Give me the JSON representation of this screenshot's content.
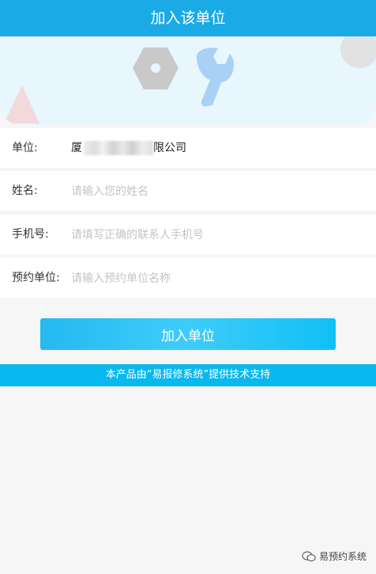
{
  "header": {
    "title": "加入该单位"
  },
  "banner": {
    "icons": [
      "hexagon-nut-icon",
      "wrench-icon",
      "triangle-decoration",
      "circle-decoration"
    ],
    "colors": {
      "background": "#e8f6fd",
      "nut": "#c9c9c9",
      "wrench": "#a9d0f5",
      "triangle": "#f3d9dc",
      "circle": "#e2e2e2"
    }
  },
  "form": {
    "unit": {
      "label": "单位:",
      "value_prefix": "厦",
      "value_suffix": "限公司"
    },
    "name": {
      "label": "姓名:",
      "placeholder": "请输入您的姓名",
      "value": ""
    },
    "phone": {
      "label": "手机号:",
      "placeholder": "请填写正确的联系人手机号",
      "value": ""
    },
    "booking_unit": {
      "label": "预约单位:",
      "placeholder": "请输入预约单位名称",
      "value": ""
    }
  },
  "actions": {
    "join_label": "加入单位"
  },
  "footer": {
    "support_text": "本产品由“易报修系统”提供技术支持"
  },
  "watermark": {
    "text": "易预约系统",
    "icon": "wechat-bubble-icon"
  },
  "colors": {
    "header": "#1aabe6",
    "button": "#2bc0f3",
    "footer_bar": "#08b8ee",
    "page_background": "#f6f6f6"
  }
}
